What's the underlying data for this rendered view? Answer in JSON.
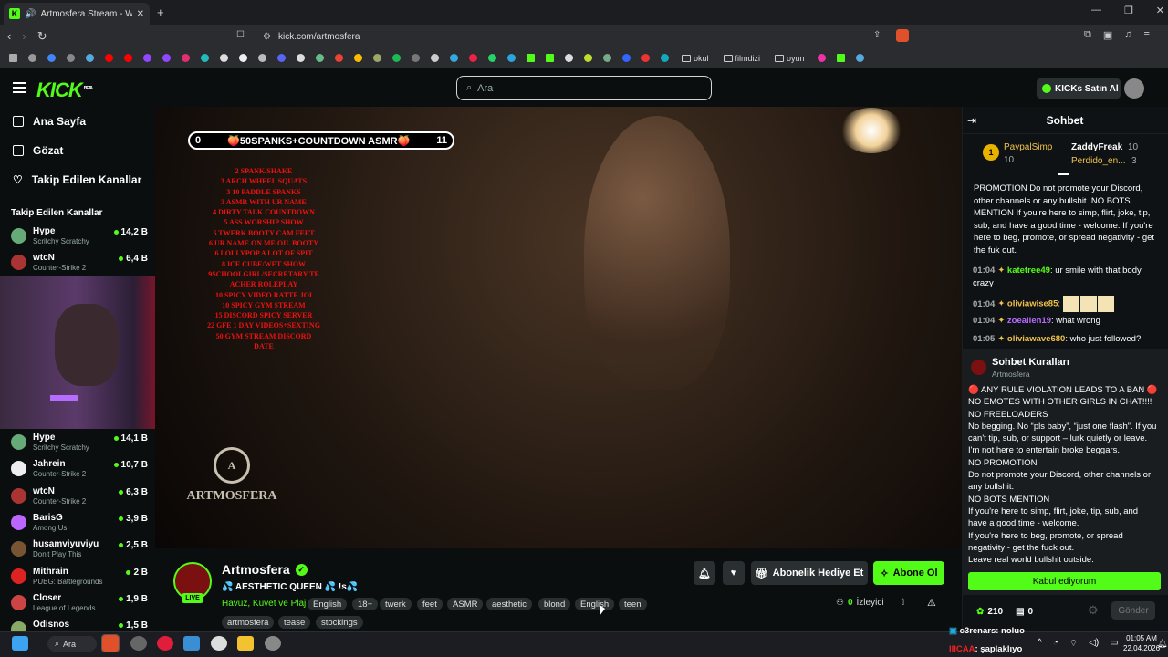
{
  "browser": {
    "tab_title": "Artmosfera Stream - Watch L...",
    "url": "kick.com/artmosfera",
    "bookmark_folders": [
      "okul",
      "filmdizi",
      "oyun"
    ]
  },
  "header": {
    "logo": "KICK",
    "beta": "BETA",
    "search_placeholder": "Ara",
    "buy_kicks": "KICKs Satın Al"
  },
  "sidebar": {
    "nav": [
      {
        "label": "Ana Sayfa",
        "icon": "home-icon"
      },
      {
        "label": "Gözat",
        "icon": "browse-icon"
      },
      {
        "label": "Takip Edilen Kanallar",
        "icon": "heart-icon"
      }
    ],
    "section_title": "Takip Edilen Kanallar",
    "channels": [
      {
        "name": "Hype",
        "category": "Scritchy Scratchy",
        "viewers": "14,2 B"
      },
      {
        "name": "wtcN",
        "category": "Counter-Strike 2",
        "viewers": "6,4 B"
      },
      {
        "name": "Hype",
        "category": "Scritchy Scratchy",
        "viewers": "14,1 B"
      },
      {
        "name": "Jahrein",
        "category": "Counter-Strike 2",
        "viewers": "10,7 B"
      },
      {
        "name": "wtcN",
        "category": "Counter-Strike 2",
        "viewers": "6,3 B"
      },
      {
        "name": "BarisG",
        "category": "Among Us",
        "viewers": "3,9 B"
      },
      {
        "name": "husamviyuviyu",
        "category": "Don't Play This",
        "viewers": "2,5 B"
      },
      {
        "name": "Mithrain",
        "category": "PUBG: Battlegrounds",
        "viewers": "2 B"
      },
      {
        "name": "Closer",
        "category": "League of Legends",
        "viewers": "1,9 B"
      },
      {
        "name": "Odisnos",
        "category": "",
        "viewers": "1,5 B"
      }
    ]
  },
  "video": {
    "countdown_left": "0",
    "countdown_text": "🍑50SPANKS+COUNTDOWN ASMR🍑",
    "countdown_right": "11",
    "menu_items": [
      "2 SPANK/SHAKE",
      "3 ARCH WHEEL SQUATS",
      "3 10 PADDLE SPANKS",
      "3 ASMR WITH UR NAME",
      "4 DIRTY TALK COUNTDOWN",
      "5 ASS WORSHIP SHOW",
      "5 TWERK BOOTY CAM FEET",
      "6 UR NAME ON ME OIL BOOTY",
      "6 LOLLYPOP A LOT OF SPIT",
      "8 ICE CUBE/WET SHOW",
      "9SCHOOLGIRL/SECRETARY TE",
      "ACHER ROLEPLAY",
      "10 SPICY VIDEO RATTE JOI",
      "10 SPICY GYM STREAM",
      "15 DISCORD SPICY SERVER",
      "22 GFE 1 DAY VIDEOS+SEXTING",
      "50 GYM STREAM DISCORD",
      "DATE"
    ],
    "watermark": "ARTMOSFERA",
    "watermark_letter": "A"
  },
  "stream": {
    "name": "Artmosfera",
    "title": "💦 AESTHETIC QUEEN 💦 !s💦",
    "category": "Havuz, Küvet ve Plaj",
    "live_badge": "LIVE",
    "tags": [
      "English",
      "18+",
      "twerk",
      "feet",
      "ASMR",
      "aesthetic",
      "blond",
      "English",
      "teen",
      "artmosfera",
      "tease",
      "stockings"
    ],
    "gift_sub_label": "Abonelik Hediye Et",
    "subscribe_label": "Abone Ol",
    "viewers_count": "0",
    "viewers_label": "İzleyici"
  },
  "chat": {
    "title": "Sohbet",
    "gifters": [
      {
        "name": "PaypalSimp",
        "count": "10"
      },
      {
        "name": "ZaddyFreak",
        "count": "10"
      },
      {
        "name": "Perdido_en...",
        "count": "3"
      }
    ],
    "pinned_text": "PROMOTION Do not promote your Discord, other channels or any bullshit. NO BOTS MENTION If you're here to simp, flirt, joke, tip, sub, and have a good time - welcome. If you're here to beg, promote, or spread negativity - get the fuk out.",
    "messages": [
      {
        "time": "01:04",
        "user": "katetree49",
        "text": "ur smile with that body crazy",
        "color": "#53fc18"
      },
      {
        "time": "01:04",
        "user": "oliviawise85",
        "text": "",
        "color": "#f0c24a"
      },
      {
        "time": "01:04",
        "user": "zoeallen19",
        "text": "what wrong",
        "color": "#b66cff"
      },
      {
        "time": "01:05",
        "user": "oliviawave680",
        "text": "who just followed?",
        "color": "#f0c24a"
      }
    ],
    "rules_title": "Sohbet Kuralları",
    "rules_subtitle": "Artmosfera",
    "rules_lines": [
      "🔴 ANY RULE VIOLATION LEADS TO A BAN 🔴",
      "NO EMOTES WITH OTHER GIRLS IN CHAT!!!!",
      "NO FREELOADERS",
      "No begging. No “pls baby”, “just one flash”. If you can't tip, sub, or support – lurk quietly or leave. I'm not here to entertain broke beggars.",
      "NO PROMOTION",
      "Do not promote your Discord, other channels or any bullshit.",
      "NO BOTS MENTION",
      "If you're here to simp, flirt, joke, tip, sub, and have a good time - welcome.",
      "If you're here to beg, promote, or spread negativity - get the fuck out.",
      "Leave real world bullshit outside."
    ],
    "accept_label": "Kabul ediyorum",
    "kicks_count": "210",
    "sub_count": "0",
    "send_label": "Gönder"
  },
  "taskbar": {
    "search_label": "Ara",
    "time": "01:05 AM",
    "date": "22.04.2026",
    "notifications": [
      {
        "user": "c3renars",
        "text": ": noluo"
      },
      {
        "user": "IIICAA",
        "text": ": şaplaklıyo"
      }
    ]
  }
}
